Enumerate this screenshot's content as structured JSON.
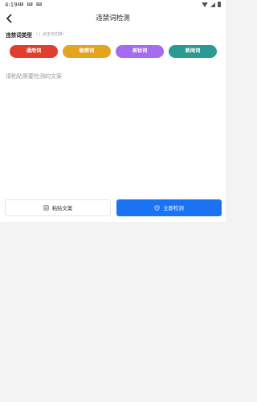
{
  "status": {
    "time": "4:19",
    "notifications": [
      "“h”",
      "“h”",
      "“h”"
    ]
  },
  "header": {
    "title": "违禁词检测"
  },
  "section": {
    "label": "违禁词类型",
    "hint": "（↓ 点击可切换）"
  },
  "chips": [
    {
      "label": "通用词",
      "color": "#e03f2d"
    },
    {
      "label": "敏感词",
      "color": "#e4a41f"
    },
    {
      "label": "美妆词",
      "color": "#a56cf0"
    },
    {
      "label": "新闻词",
      "color": "#2b9a92"
    }
  ],
  "input": {
    "placeholder": "请粘贴需要检测的文案"
  },
  "buttons": {
    "paste": "粘贴文案",
    "check": "立即检测"
  },
  "colors": {
    "primary": "#1a73f5"
  }
}
